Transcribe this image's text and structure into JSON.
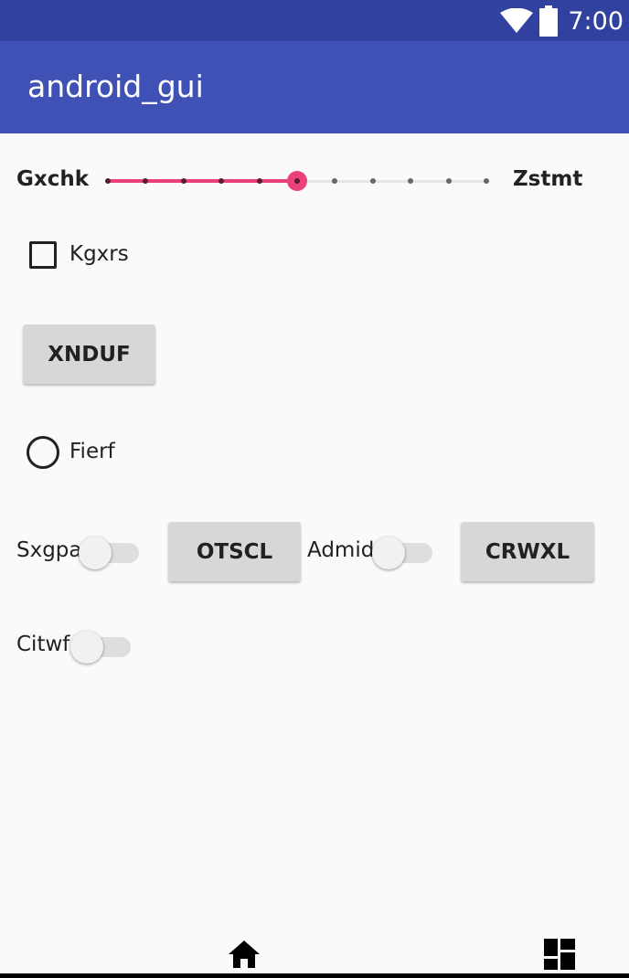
{
  "status_bar": {
    "time": "7:00",
    "icons": [
      "wifi-icon",
      "battery-icon"
    ]
  },
  "app_bar": {
    "title": "android_gui"
  },
  "slider": {
    "start_label": "Gxchk",
    "end_label": "Zstmt",
    "value": 5,
    "max": 10
  },
  "checkbox": {
    "label": "Kgxrs",
    "checked": false
  },
  "button_xnduf": {
    "label": "XNDUF"
  },
  "radio": {
    "label": "Fierf",
    "checked": false
  },
  "row": {
    "switch1_label": "Sxgpa",
    "button_otscl_label": "OTSCL",
    "switch2_label": "Admid",
    "button_crwxl_label": "CRWXL"
  },
  "switch3": {
    "label": "Citwf"
  },
  "colors": {
    "status_bar": "#3041a0",
    "app_bar": "#3f51b5",
    "accent": "#ec407a",
    "background": "#fafafa"
  },
  "nav_bar": {
    "icons": [
      "home-icon",
      "dashboard-icon"
    ]
  }
}
